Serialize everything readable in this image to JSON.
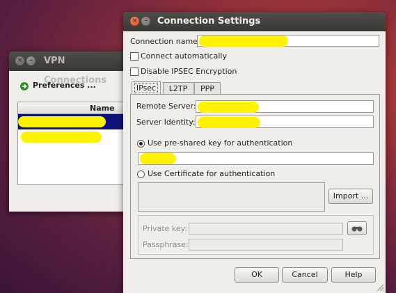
{
  "vpn_window": {
    "title": "VPN Connections",
    "preferences_label": "Preferences ...",
    "list": {
      "column_header": "Name",
      "rows": [
        {
          "name": "",
          "selected": true
        },
        {
          "name": "",
          "selected": false
        }
      ]
    }
  },
  "settings_window": {
    "title": "Connection Settings",
    "connection_name_label": "Connection name:",
    "connection_name_value": "",
    "connect_automatically_label": "Connect automatically",
    "connect_automatically_checked": false,
    "disable_ipsec_label": "Disable IPSEC Encryption",
    "disable_ipsec_checked": false,
    "tabs": [
      {
        "label": "IPsec",
        "active": true
      },
      {
        "label": "L2TP",
        "active": false
      },
      {
        "label": "PPP",
        "active": false
      }
    ],
    "ipsec": {
      "remote_server_label": "Remote Server:",
      "remote_server_value": "",
      "server_identity_label": "Server Identity:",
      "server_identity_value": "",
      "psk_radio_label": "Use pre-shared key for authentication",
      "psk_selected": true,
      "psk_value": "",
      "cert_radio_label": "Use Certificate for authentication",
      "cert_selected": false,
      "import_button": "Import ...",
      "private_key_label": "Private key:",
      "passphrase_label": "Passphrase:"
    },
    "buttons": {
      "ok": "OK",
      "cancel": "Cancel",
      "help": "Help"
    }
  },
  "colors": {
    "selection": "#10137a",
    "highlight_mark": "#fff200",
    "close_button": "#e8582a"
  }
}
